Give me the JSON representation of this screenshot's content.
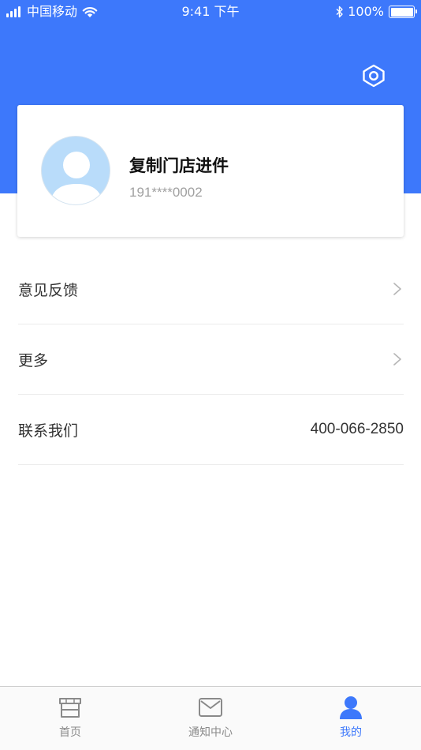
{
  "status_bar": {
    "carrier": "中国移动",
    "time": "9:41 下午",
    "battery": "100%"
  },
  "header": {
    "settings_icon": "gear-icon",
    "background_color": "#3d78fb"
  },
  "profile": {
    "name": "复制门店进件",
    "phone": "191****0002",
    "avatar_icon": "default-avatar-icon"
  },
  "menu": {
    "items": [
      {
        "label": "意见反馈",
        "icon": "chevron-right-icon"
      },
      {
        "label": "更多",
        "icon": "chevron-right-icon"
      },
      {
        "label": "联系我们",
        "value": "400-066-2850"
      }
    ]
  },
  "tabbar": {
    "active_color": "#3d78fb",
    "items": [
      {
        "label": "首页",
        "icon": "store-icon"
      },
      {
        "label": "通知中心",
        "icon": "mail-icon"
      },
      {
        "label": "我的",
        "icon": "user-icon",
        "active": true
      }
    ]
  }
}
